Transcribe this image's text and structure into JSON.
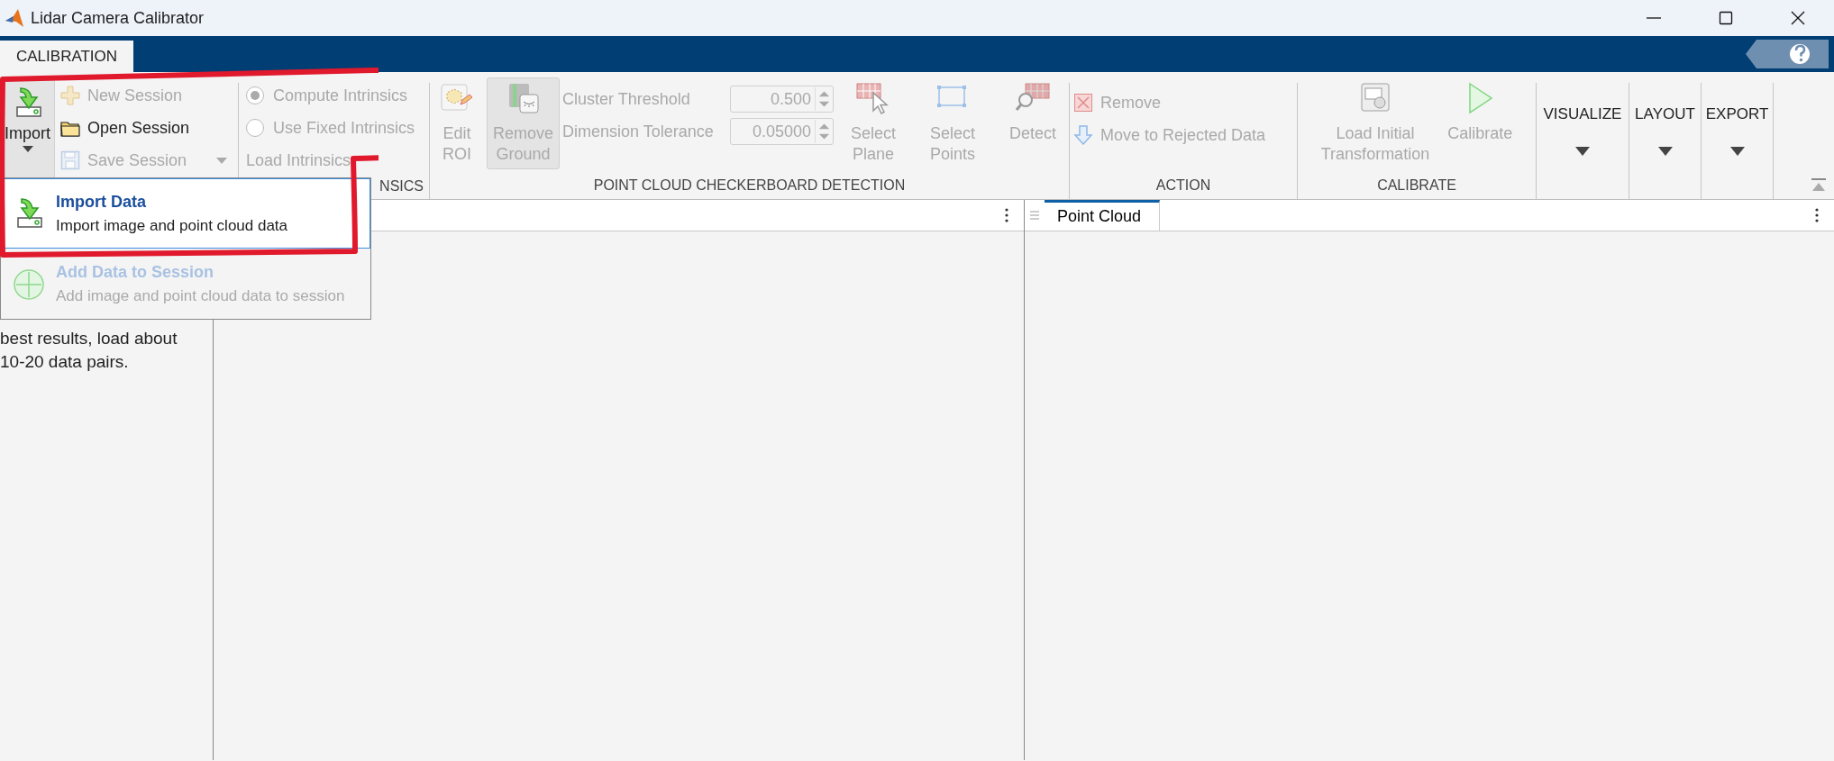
{
  "window": {
    "title": "Lidar Camera Calibrator"
  },
  "ribbon_tabs": [
    {
      "label": "CALIBRATION",
      "selected": true
    }
  ],
  "file_section": {
    "import": {
      "label": "Import",
      "pressed": true
    },
    "items": [
      {
        "label": "New Session",
        "disabled": true
      },
      {
        "label": "Open Session",
        "disabled": false
      },
      {
        "label": "Save Session",
        "disabled": true
      }
    ]
  },
  "intrinsics_section": {
    "label": "NSICS",
    "options": [
      {
        "label": "Compute Intrinsics",
        "selected": true,
        "disabled": true
      },
      {
        "label": "Use Fixed Intrinsics",
        "selected": false,
        "disabled": true
      }
    ],
    "load_label": "Load Intrinsics"
  },
  "detection_section": {
    "label": "POINT CLOUD CHECKERBOARD DETECTION",
    "items": [
      {
        "kind": "tool",
        "lines": [
          "Edit",
          "ROI"
        ],
        "disabled": true,
        "pressed": false
      },
      {
        "kind": "tool",
        "lines": [
          "Remove",
          "Ground"
        ],
        "disabled": true,
        "pressed": true
      },
      {
        "kind": "fields",
        "fields": [
          {
            "label": "Cluster Threshold",
            "value": "0.500",
            "disabled": true
          },
          {
            "label": "Dimension Tolerance",
            "value": "0.05000",
            "disabled": true
          }
        ]
      },
      {
        "kind": "tool",
        "lines": [
          "Select",
          "Plane"
        ],
        "disabled": true,
        "pressed": false
      },
      {
        "kind": "tool",
        "lines": [
          "Select",
          "Points"
        ],
        "disabled": true,
        "pressed": false
      },
      {
        "kind": "tool",
        "lines": [
          "Detect"
        ],
        "disabled": true,
        "pressed": false
      }
    ]
  },
  "action_section": {
    "label": "ACTION",
    "items": [
      {
        "label": "Remove",
        "disabled": true
      },
      {
        "label": "Move to Rejected Data",
        "disabled": true
      }
    ]
  },
  "calibrate_section": {
    "label": "CALIBRATE",
    "tools": [
      {
        "lines": [
          "Load Initial",
          "Transformation"
        ],
        "disabled": true
      },
      {
        "lines": [
          "Calibrate"
        ],
        "disabled": true
      }
    ]
  },
  "menus": [
    {
      "label": "VISUALIZE"
    },
    {
      "label": "LAYOUT"
    },
    {
      "label": "EXPORT"
    }
  ],
  "sidebar": {
    "text": "best results, load about 10-20 data pairs."
  },
  "panels": [
    {
      "kind": "document"
    },
    {
      "kind": "view",
      "tabs": [
        {
          "label": "Point Cloud",
          "selected": true
        }
      ]
    }
  ],
  "import_menu": {
    "items": [
      {
        "title": "Import Data",
        "description": "Import image and point cloud data",
        "selected": true,
        "disabled": false
      },
      {
        "title": "Add Data to Session",
        "description": "Add image and point cloud data to session",
        "selected": false,
        "disabled": true
      }
    ]
  }
}
